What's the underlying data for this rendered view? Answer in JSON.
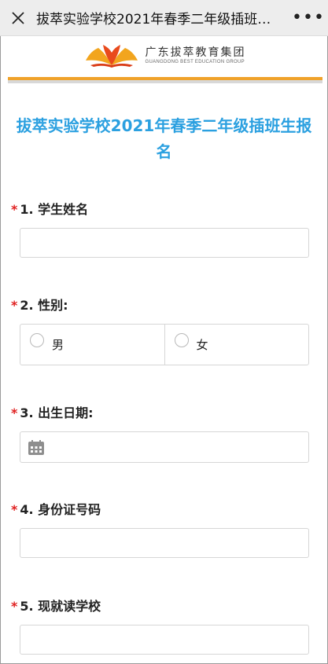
{
  "window": {
    "title": "拔萃实验学校2021年春季二年级插班生...",
    "close_icon": "close-icon",
    "more_label": "•••"
  },
  "header": {
    "logo_cn": "广东拔萃教育集团",
    "logo_en": "GUANGDONG BEST EDUCATION GROUP"
  },
  "form": {
    "title_line1": "拔萃实验学校2021年春季二年级插班生报",
    "title_line2": "名",
    "required_mark": "*",
    "questions": {
      "q1": {
        "label": "1. 学生姓名",
        "value": ""
      },
      "q2": {
        "label": "2. 性别:",
        "options": [
          "男",
          "女"
        ]
      },
      "q3": {
        "label": "3. 出生日期:",
        "value": ""
      },
      "q4": {
        "label": "4. 身份证号码",
        "value": ""
      },
      "q5": {
        "label": "5. 现就读学校",
        "value": ""
      }
    }
  },
  "colors": {
    "title_blue": "#2ba0e0",
    "required_red": "#e02020",
    "accent_orange": "#f0a22a"
  }
}
